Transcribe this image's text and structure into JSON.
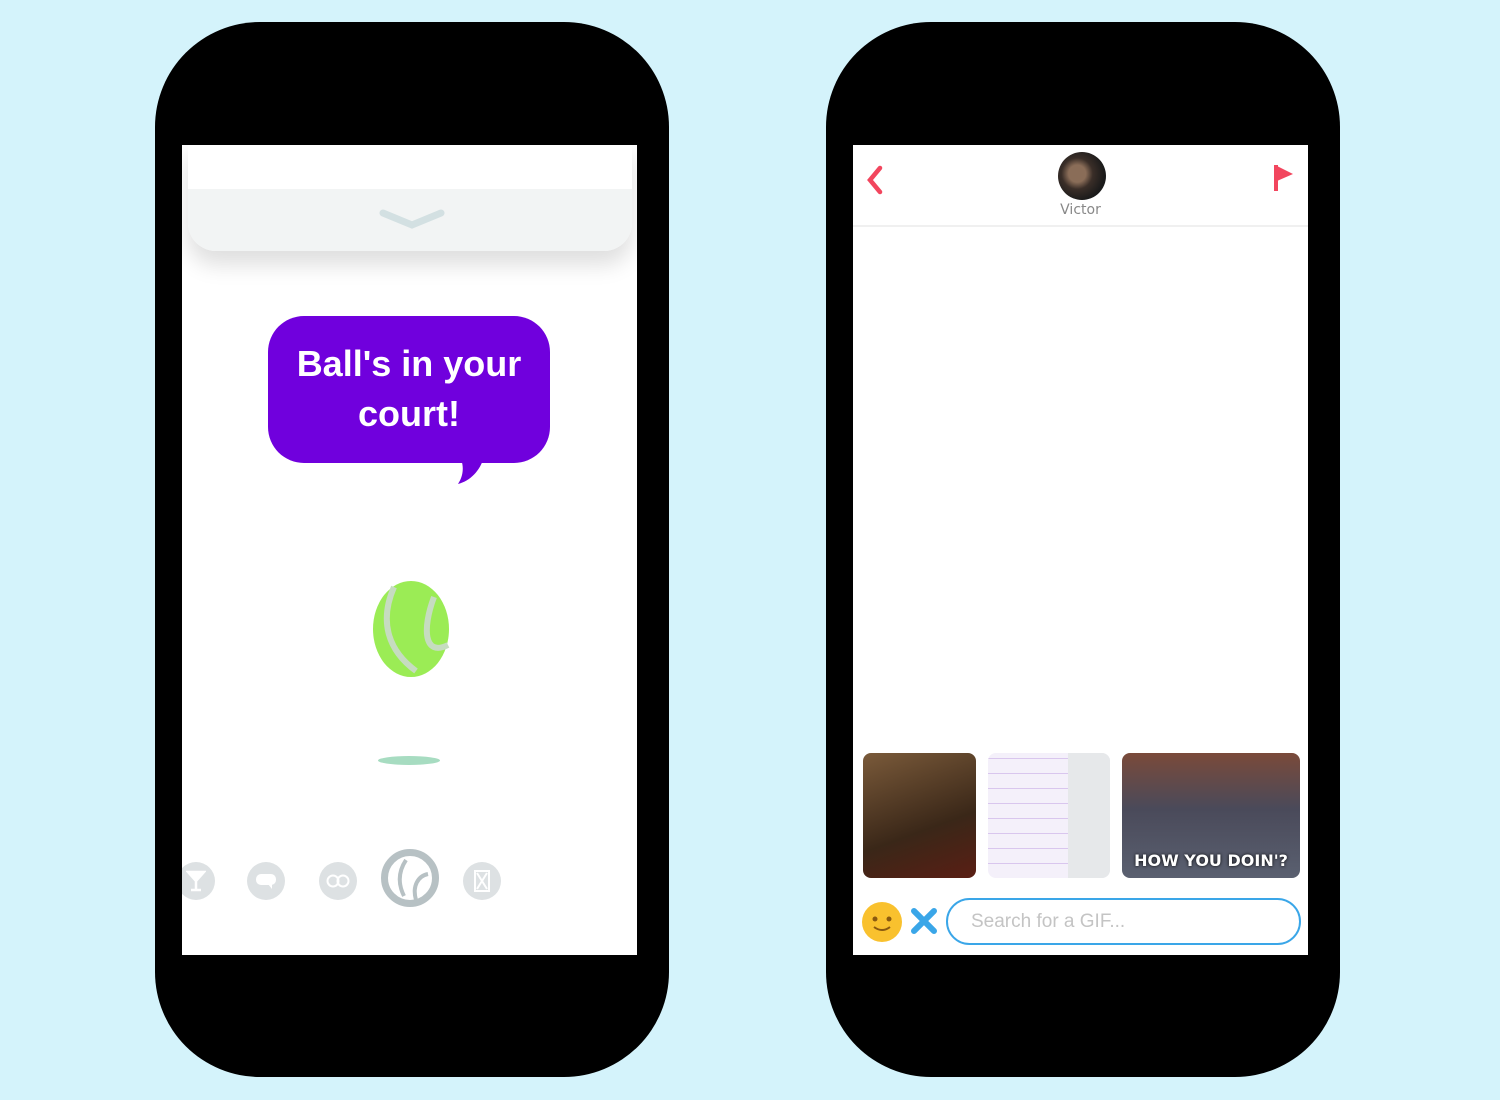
{
  "colors": {
    "background": "#d4f3fb",
    "bubble": "#7000dd",
    "accent_red": "#f2465e",
    "accent_blue": "#3aa6e8",
    "emoji_yellow": "#f9c12e"
  },
  "left_phone": {
    "bubble_text": "Ball's in your court!",
    "icons": [
      "cocktail-icon",
      "speech-bubble-icon",
      "eyes-icon",
      "tennis-ball-icon",
      "hourglass-icon"
    ],
    "selected_icon": "tennis-ball-icon"
  },
  "right_phone": {
    "header": {
      "name": "Victor",
      "back_icon": "chevron-left-icon",
      "report_icon": "flag-icon"
    },
    "gifs": [
      {
        "caption": ""
      },
      {
        "caption": ""
      },
      {
        "caption": "HOW YOU DOIN'?"
      }
    ],
    "search": {
      "placeholder": "Search for a GIF...",
      "value": ""
    }
  }
}
